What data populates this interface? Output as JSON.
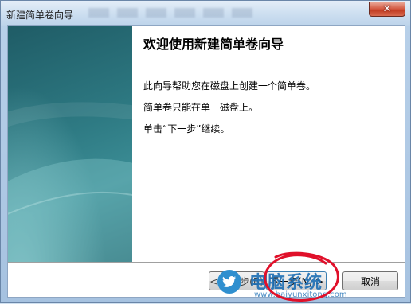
{
  "window": {
    "title": "新建简单卷向导",
    "close_glyph": "✕"
  },
  "wizard": {
    "heading": "欢迎使用新建简单卷向导",
    "paragraphs": [
      "此向导帮助您在磁盘上创建一个简单卷。",
      "简单卷只能在单一磁盘上。",
      "单击“下一步”继续。"
    ]
  },
  "buttons": {
    "back_label": "< 上一步(B)",
    "next_label": "下一步(N) >",
    "cancel_label": "取消"
  },
  "watermark": {
    "text": "电脑系统",
    "url": "www.baiyunxitong.com",
    "icon": "twitter-bird-icon"
  },
  "colors": {
    "side_panel": "#2e7a83",
    "annotation": "#e0102a",
    "close_button": "#c0391f"
  }
}
